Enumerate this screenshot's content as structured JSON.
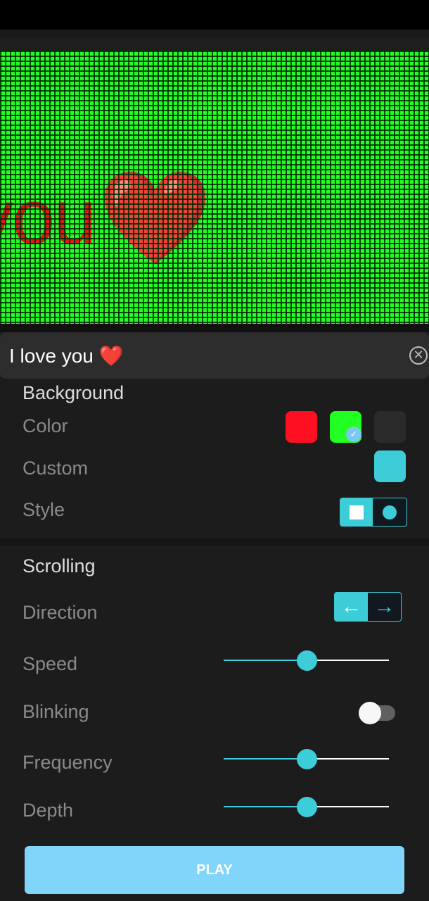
{
  "preview": {
    "visible_text": "veyou",
    "emoji": "❤️",
    "background_color": "#22ff22",
    "text_color": "#e01818"
  },
  "input": {
    "value": "I love you ❤️",
    "clear_icon": "clear-circle-icon"
  },
  "background": {
    "title": "Background",
    "color_label": "Color",
    "colors": [
      "#ff1020",
      "#22ff22",
      "#2a2a2a"
    ],
    "selected_color_index": 1,
    "custom_label": "Custom",
    "custom_color": "#3ccdd8",
    "style_label": "Style",
    "style_options": [
      "square",
      "circle"
    ],
    "style_selected": "square"
  },
  "scrolling": {
    "title": "Scrolling",
    "direction_label": "Direction",
    "direction_options": [
      "left",
      "right"
    ],
    "direction_selected": "left",
    "speed_label": "Speed",
    "speed_value": 0.5,
    "blinking_label": "Blinking",
    "blinking_on": false,
    "frequency_label": "Frequency",
    "frequency_value": 0.5,
    "depth_label": "Depth",
    "depth_value": 0.5
  },
  "play_label": "PLAY",
  "accent": "#3ccdd8"
}
